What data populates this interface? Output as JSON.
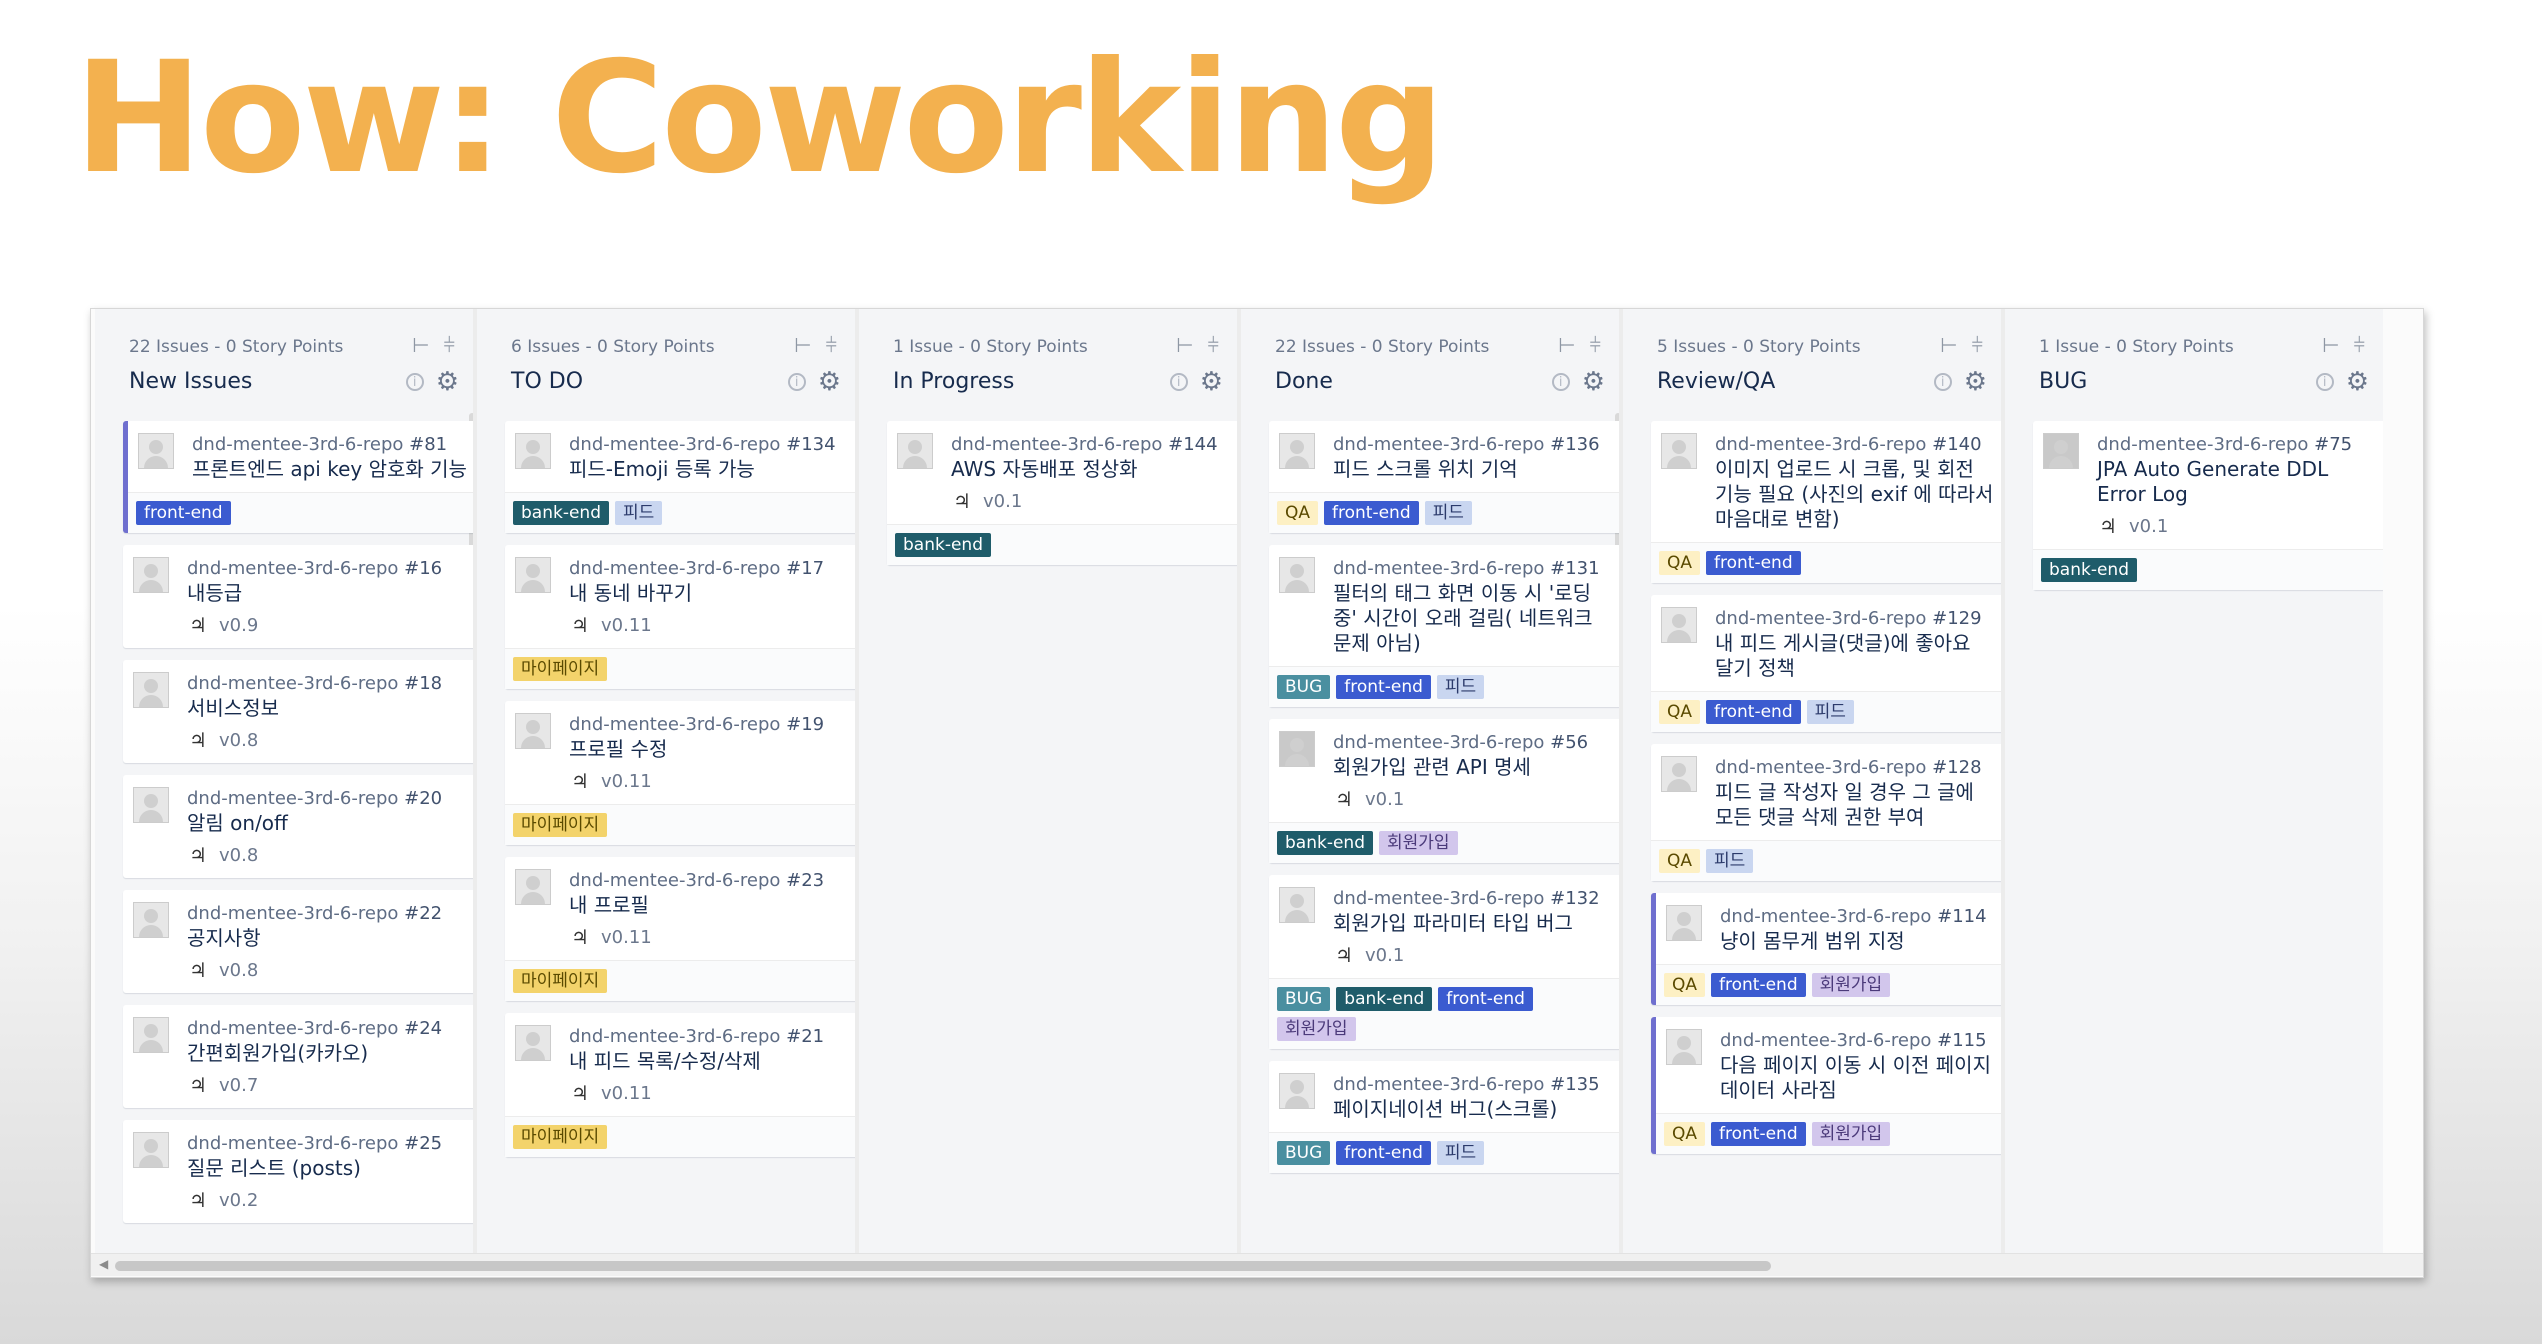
{
  "slide": {
    "title": "How: Coworking"
  },
  "colors": {
    "title": "#f3b14f",
    "accent_bar": "#6f6fcf",
    "label_styles": {
      "front-end": {
        "bg": "#3b5bd0",
        "fg": "#ffffff"
      },
      "bank-end": {
        "bg": "#1f5c6a",
        "fg": "#ffffff"
      },
      "피드": {
        "bg": "#c9d6f0",
        "fg": "#2b3a6b"
      },
      "마이페이지": {
        "bg": "#f3d36b",
        "fg": "#5a4a00"
      },
      "QA": {
        "bg": "#fdf0c4",
        "fg": "#5a4a00"
      },
      "BUG": {
        "bg": "#4a8fa0",
        "fg": "#ffffff"
      },
      "회원가입": {
        "bg": "#d2c6ec",
        "fg": "#4b3a7a"
      }
    }
  },
  "board": {
    "columns": [
      {
        "meta": "22 Issues - 0 Story Points",
        "title": "New Issues",
        "has_scroll": true,
        "cards": [
          {
            "key": "dnd-mentee-3rd-6-repo",
            "num": "#81",
            "summary": "프론트엔드 api key 암호화 기능",
            "version": "",
            "labels": [
              "front-end"
            ],
            "accent": true,
            "photo": false
          },
          {
            "key": "dnd-mentee-3rd-6-repo",
            "num": "#16",
            "summary": "내등급",
            "version": "v0.9",
            "labels": [],
            "accent": false,
            "photo": false
          },
          {
            "key": "dnd-mentee-3rd-6-repo",
            "num": "#18",
            "summary": "서비스정보",
            "version": "v0.8",
            "labels": [],
            "accent": false,
            "photo": false
          },
          {
            "key": "dnd-mentee-3rd-6-repo",
            "num": "#20",
            "summary": "알림 on/off",
            "version": "v0.8",
            "labels": [],
            "accent": false,
            "photo": false
          },
          {
            "key": "dnd-mentee-3rd-6-repo",
            "num": "#22",
            "summary": "공지사항",
            "version": "v0.8",
            "labels": [],
            "accent": false,
            "photo": false
          },
          {
            "key": "dnd-mentee-3rd-6-repo",
            "num": "#24",
            "summary": "간편회원가입(카카오)",
            "version": "v0.7",
            "labels": [],
            "accent": false,
            "photo": false
          },
          {
            "key": "dnd-mentee-3rd-6-repo",
            "num": "#25",
            "summary": "질문 리스트 (posts)",
            "version": "v0.2",
            "labels": [],
            "accent": false,
            "photo": false
          }
        ]
      },
      {
        "meta": "6 Issues - 0 Story Points",
        "title": "TO DO",
        "has_scroll": false,
        "cards": [
          {
            "key": "dnd-mentee-3rd-6-repo",
            "num": "#134",
            "summary": "피드-Emoji 등록 가능",
            "version": "",
            "labels": [
              "bank-end",
              "피드"
            ],
            "accent": false,
            "photo": false
          },
          {
            "key": "dnd-mentee-3rd-6-repo",
            "num": "#17",
            "summary": "내 동네 바꾸기",
            "version": "v0.11",
            "labels": [
              "마이페이지"
            ],
            "accent": false,
            "photo": false
          },
          {
            "key": "dnd-mentee-3rd-6-repo",
            "num": "#19",
            "summary": "프로필 수정",
            "version": "v0.11",
            "labels": [
              "마이페이지"
            ],
            "accent": false,
            "photo": false
          },
          {
            "key": "dnd-mentee-3rd-6-repo",
            "num": "#23",
            "summary": "내 프로필",
            "version": "v0.11",
            "labels": [
              "마이페이지"
            ],
            "accent": false,
            "photo": false
          },
          {
            "key": "dnd-mentee-3rd-6-repo",
            "num": "#21",
            "summary": "내 피드 목록/수정/삭제",
            "version": "v0.11",
            "labels": [
              "마이페이지"
            ],
            "accent": false,
            "photo": false
          }
        ]
      },
      {
        "meta": "1 Issue - 0 Story Points",
        "title": "In Progress",
        "has_scroll": false,
        "cards": [
          {
            "key": "dnd-mentee-3rd-6-repo",
            "num": "#144",
            "summary": "AWS 자동배포 정상화",
            "version": "v0.1",
            "labels": [
              "bank-end"
            ],
            "accent": false,
            "photo": false
          }
        ]
      },
      {
        "meta": "22 Issues - 0 Story Points",
        "title": "Done",
        "has_scroll": true,
        "cards": [
          {
            "key": "dnd-mentee-3rd-6-repo",
            "num": "#136",
            "summary": "피드 스크롤 위치 기억",
            "version": "",
            "labels": [
              "QA",
              "front-end",
              "피드"
            ],
            "accent": false,
            "photo": false
          },
          {
            "key": "dnd-mentee-3rd-6-repo",
            "num": "#131",
            "summary": "필터의 태그 화면 이동 시 '로딩중' 시간이 오래 걸림( 네트워크 문제 아님)",
            "version": "",
            "labels": [
              "BUG",
              "front-end",
              "피드"
            ],
            "accent": false,
            "photo": false
          },
          {
            "key": "dnd-mentee-3rd-6-repo",
            "num": "#56",
            "summary": "회원가입 관련 API 명세",
            "version": "v0.1",
            "labels": [
              "bank-end",
              "회원가입"
            ],
            "accent": false,
            "photo": true
          },
          {
            "key": "dnd-mentee-3rd-6-repo",
            "num": "#132",
            "summary": "회원가입 파라미터 타입 버그",
            "version": "v0.1",
            "labels": [
              "BUG",
              "bank-end",
              "front-end",
              "회원가입"
            ],
            "accent": false,
            "photo": false
          },
          {
            "key": "dnd-mentee-3rd-6-repo",
            "num": "#135",
            "summary": "페이지네이션 버그(스크롤)",
            "version": "",
            "labels": [
              "BUG",
              "front-end",
              "피드"
            ],
            "accent": false,
            "photo": false
          }
        ]
      },
      {
        "meta": "5 Issues - 0 Story Points",
        "title": "Review/QA",
        "has_scroll": false,
        "cards": [
          {
            "key": "dnd-mentee-3rd-6-repo",
            "num": "#140",
            "summary": "이미지 업로드 시 크롭, 및 회전 기능 필요 (사진의 exif 에 따라서 마음대로 변함)",
            "version": "",
            "labels": [
              "QA",
              "front-end"
            ],
            "accent": false,
            "photo": false
          },
          {
            "key": "dnd-mentee-3rd-6-repo",
            "num": "#129",
            "summary": "내 피드 게시글(댓글)에 좋아요 달기 정책",
            "version": "",
            "labels": [
              "QA",
              "front-end",
              "피드"
            ],
            "accent": false,
            "photo": false
          },
          {
            "key": "dnd-mentee-3rd-6-repo",
            "num": "#128",
            "summary": "피드 글 작성자 일 경우 그 글에 모든 댓글 삭제 권한 부여",
            "version": "",
            "labels": [
              "QA",
              "피드"
            ],
            "accent": false,
            "photo": false
          },
          {
            "key": "dnd-mentee-3rd-6-repo",
            "num": "#114",
            "summary": "냥이 몸무게 범위 지정",
            "version": "",
            "labels": [
              "QA",
              "front-end",
              "회원가입"
            ],
            "accent": true,
            "photo": false
          },
          {
            "key": "dnd-mentee-3rd-6-repo",
            "num": "#115",
            "summary": "다음 페이지 이동 시 이전 페이지 데이터 사라짐",
            "version": "",
            "labels": [
              "QA",
              "front-end",
              "회원가입"
            ],
            "accent": true,
            "photo": false
          }
        ]
      },
      {
        "meta": "1 Issue - 0 Story Points",
        "title": "BUG",
        "has_scroll": false,
        "cards": [
          {
            "key": "dnd-mentee-3rd-6-repo",
            "num": "#75",
            "summary": "JPA Auto Generate DDL Error Log",
            "version": "v0.1",
            "labels": [
              "bank-end"
            ],
            "accent": false,
            "photo": true
          }
        ]
      }
    ],
    "icons": {
      "collapse": "collapse-icon",
      "expand": "expand-icon",
      "info": "info-icon",
      "gear": "gear-icon",
      "version": "milestone-icon"
    }
  }
}
